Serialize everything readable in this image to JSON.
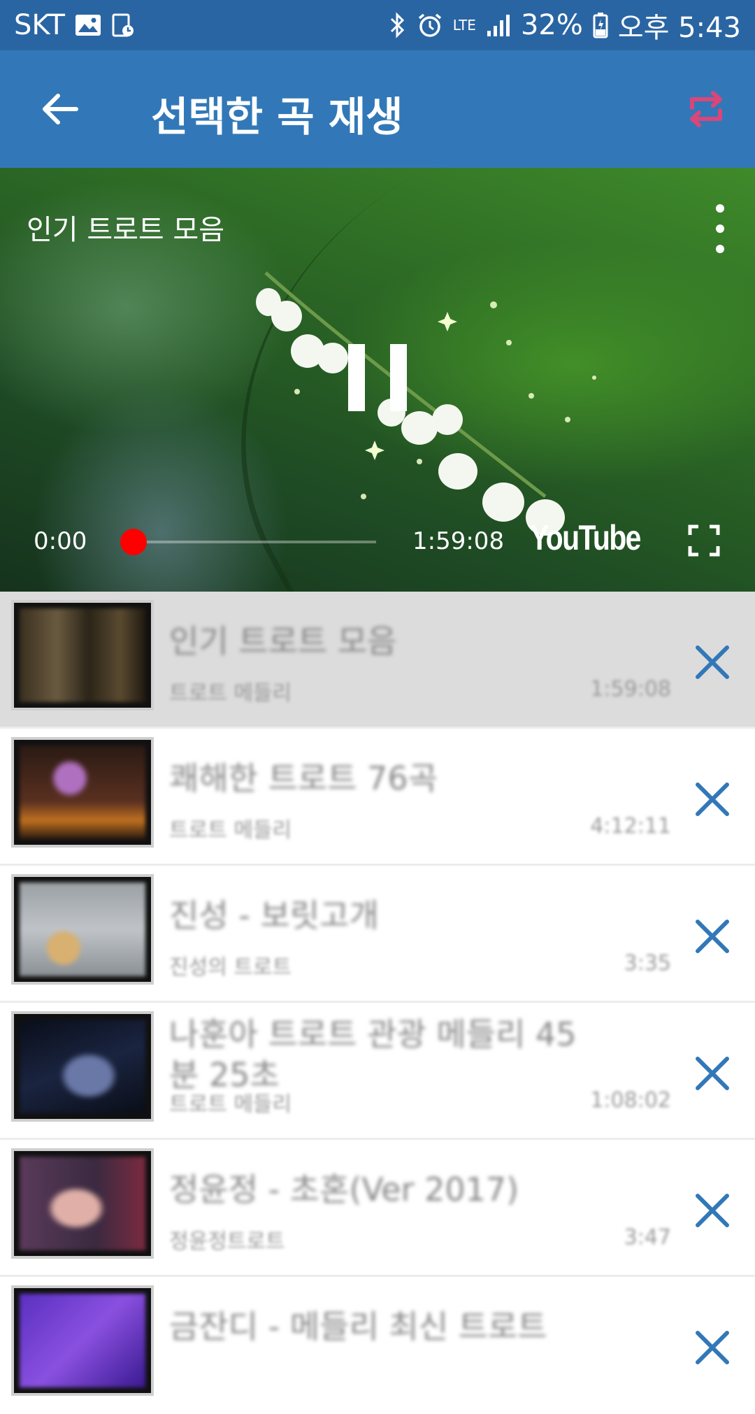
{
  "status_bar": {
    "carrier": "SKT",
    "battery": "32%",
    "time": "오후 5:43",
    "network": "LTE"
  },
  "app_bar": {
    "title": "선택한 곡 재생",
    "accent_color": "#d9467a"
  },
  "player": {
    "video_title": "인기 트로트 모음",
    "current_time": "0:00",
    "duration": "1:59:08",
    "progress_fraction": 0.0,
    "brand_logo": "YouTube"
  },
  "playlist": [
    {
      "title": "인기 트로트 모음",
      "channel": "트로트 메들리",
      "duration": "1:59:08",
      "selected": true
    },
    {
      "title": "쾌해한 트로트 76곡",
      "channel": "트로트 메들리",
      "duration": "4:12:11",
      "selected": false
    },
    {
      "title": "진성 - 보릿고개",
      "channel": "진성의 트로트",
      "duration": "3:35",
      "selected": false
    },
    {
      "title": "나훈아 트로트 관광 메들리 45분 25초",
      "channel": "트로트 메들리",
      "duration": "1:08:02",
      "selected": false
    },
    {
      "title": "정윤정 - 초혼(Ver 2017)",
      "channel": "정윤정트로트",
      "duration": "3:47",
      "selected": false
    },
    {
      "title": "금잔디 - 메들리 최신 트로트",
      "channel": "",
      "duration": "",
      "selected": false
    }
  ],
  "colors": {
    "status_bar": "#2a65a3",
    "app_bar": "#3278b8",
    "remove_icon": "#3278b8",
    "seek": "#ff0000"
  }
}
